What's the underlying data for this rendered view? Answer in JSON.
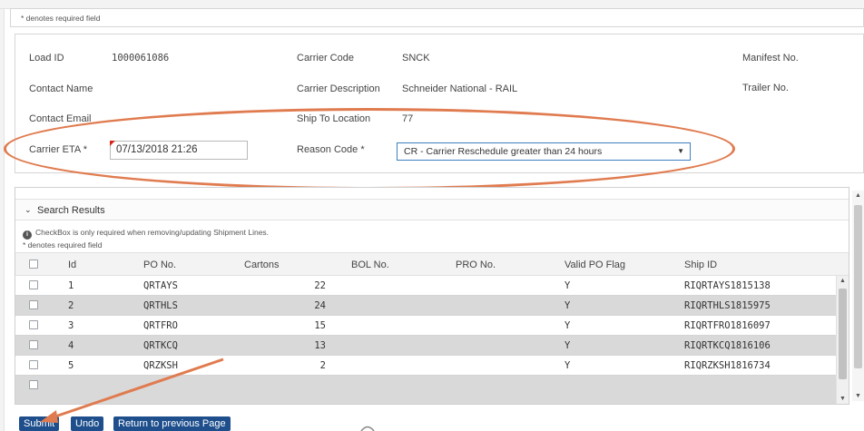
{
  "required_note": "* denotes required field",
  "form": {
    "load_id_label": "Load ID",
    "load_id_value": "1000061086",
    "contact_name_label": "Contact Name",
    "contact_email_label": "Contact Email",
    "carrier_eta_label": "Carrier ETA *",
    "carrier_eta_value": "07/13/2018 21:26",
    "carrier_code_label": "Carrier Code",
    "carrier_code_value": "SNCK",
    "carrier_description_label": "Carrier Description",
    "carrier_description_value": "Schneider National - RAIL",
    "ship_to_label": "Ship To Location",
    "ship_to_value": "77",
    "reason_code_label": "Reason Code *",
    "reason_code_value": "CR - Carrier Reschedule greater than 24 hours",
    "manifest_label": "Manifest No.",
    "trailer_label": "Trailer No."
  },
  "results": {
    "title": "Search Results",
    "info_note": "CheckBox is only required when removing/updating Shipment Lines.",
    "required_note": "* denotes required field",
    "columns": {
      "id": "Id",
      "po": "PO No.",
      "cartons": "Cartons",
      "bol": "BOL No.",
      "pro": "PRO No.",
      "valid": "Valid PO Flag",
      "ship": "Ship ID"
    },
    "rows": [
      {
        "id": "1",
        "po": "QRTAYS",
        "cartons": "22",
        "valid": "Y",
        "ship": "RIQRTAYS1815138"
      },
      {
        "id": "2",
        "po": "QRTHLS",
        "cartons": "24",
        "valid": "Y",
        "ship": "RIQRTHLS1815975"
      },
      {
        "id": "3",
        "po": "QRTFRO",
        "cartons": "15",
        "valid": "Y",
        "ship": "RIQRTFRO1816097"
      },
      {
        "id": "4",
        "po": "QRTKCQ",
        "cartons": "13",
        "valid": "Y",
        "ship": "RIQRTKCQ1816106"
      },
      {
        "id": "5",
        "po": "QRZKSH",
        "cartons": "2",
        "valid": "Y",
        "ship": "RIQRZKSH1816734"
      }
    ]
  },
  "buttons": {
    "submit": "Submit",
    "undo": "Undo",
    "return": "Return to previous Page"
  },
  "colors": {
    "annotation": "#e07b4f",
    "button": "#1e4f8c",
    "alt_row": "#d9d9d9"
  }
}
